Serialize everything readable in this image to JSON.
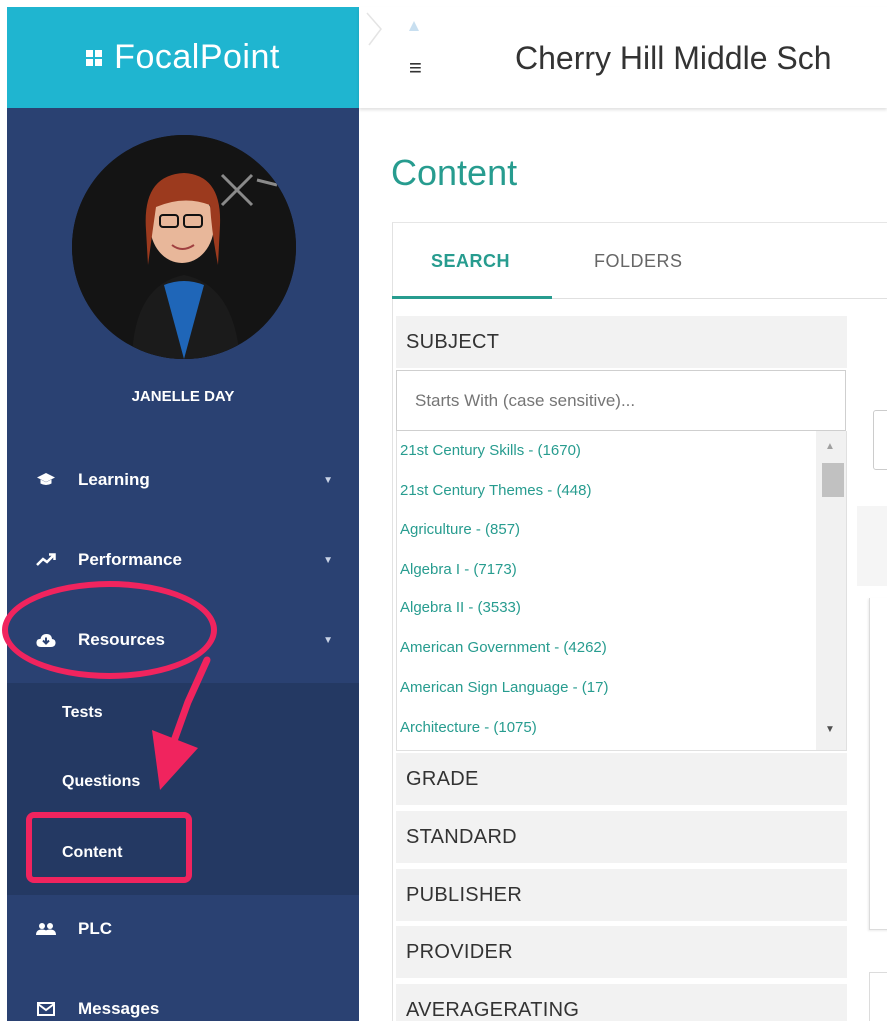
{
  "app": {
    "logo_text": "FocalPoint",
    "header_title": "Cherry Hill Middle Sch",
    "menu_icon": "hamburger-menu-icon"
  },
  "user": {
    "name": "JANELLE DAY"
  },
  "sidebar": {
    "items": [
      {
        "label": "Learning",
        "icon": "graduation-cap-icon"
      },
      {
        "label": "Performance",
        "icon": "trend-line-icon"
      },
      {
        "label": "Resources",
        "icon": "cloud-download-icon"
      },
      {
        "label": "PLC",
        "icon": "users-icon"
      },
      {
        "label": "Messages",
        "icon": "envelope-icon"
      }
    ],
    "resources_subitems": [
      {
        "label": "Tests"
      },
      {
        "label": "Questions"
      },
      {
        "label": "Content"
      }
    ]
  },
  "main": {
    "title": "Content",
    "tabs": [
      {
        "label": "SEARCH",
        "active": true
      },
      {
        "label": "FOLDERS",
        "active": false
      }
    ],
    "subject": {
      "header": "SUBJECT",
      "placeholder": "Starts With (case sensitive)...",
      "items": [
        "21st Century Skills - (1670)",
        "21st Century Themes - (448)",
        "Agriculture - (857)",
        "Algebra I - (7173)",
        "Algebra II - (3533)",
        "American Government - (4262)",
        "American Sign Language - (17)",
        "Architecture - (1075)"
      ]
    },
    "facets": [
      "GRADE",
      "STANDARD",
      "PUBLISHER",
      "PROVIDER",
      "AVERAGERATING"
    ]
  },
  "colors": {
    "sidebar_bg": "#2a4172",
    "logo_bg": "#1fb5d0",
    "accent": "#279c8f",
    "highlight": "#f0245e"
  }
}
